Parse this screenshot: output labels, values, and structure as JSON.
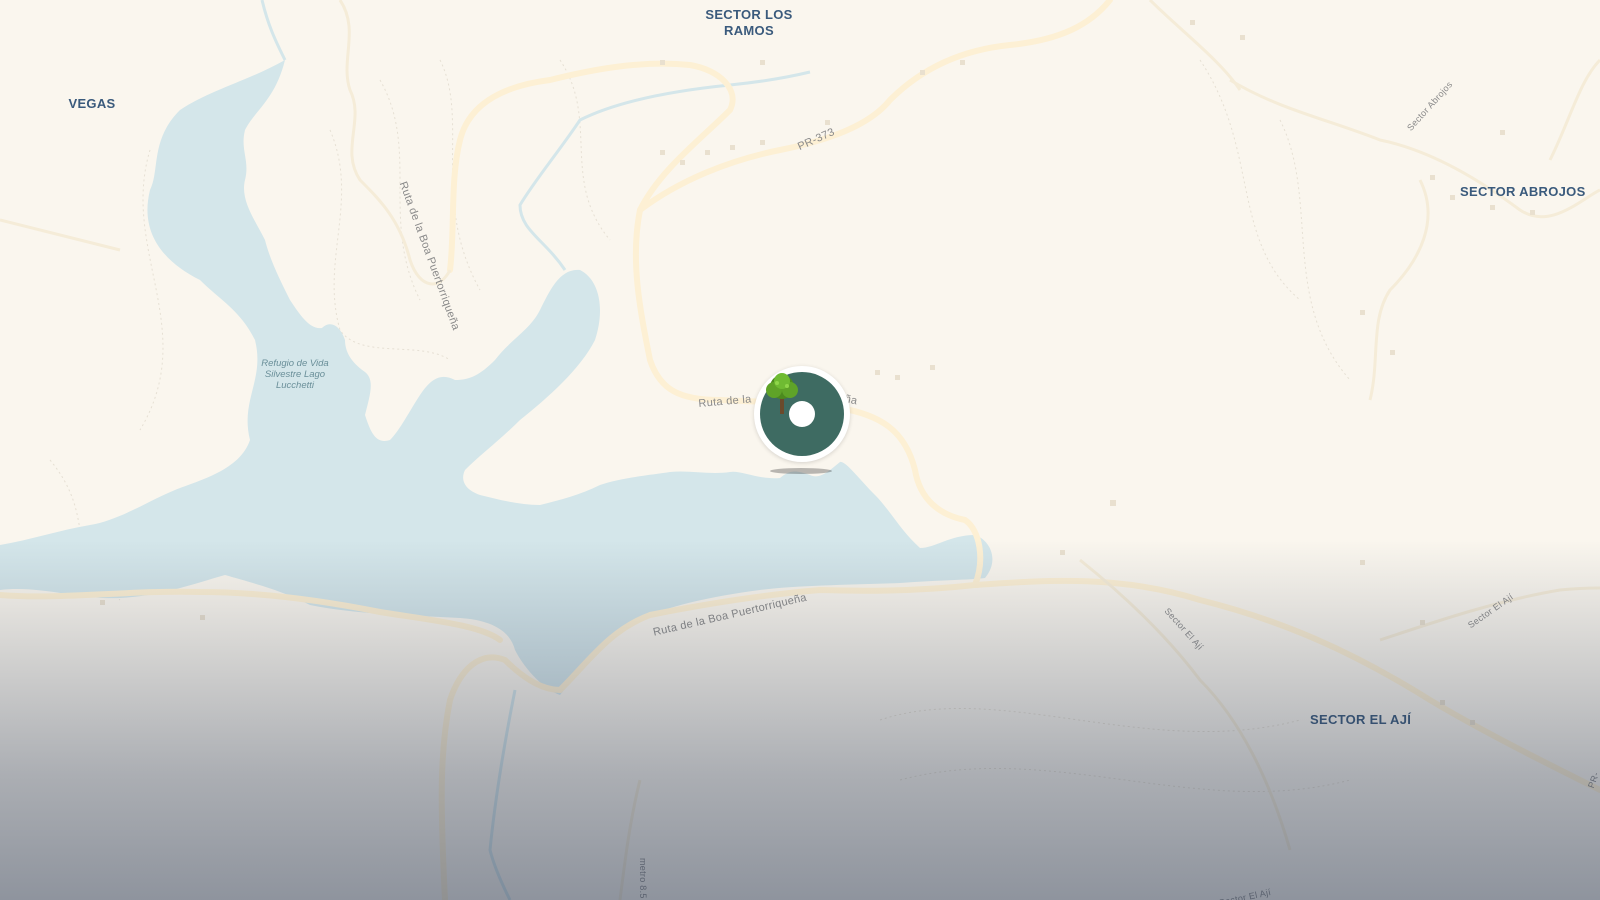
{
  "places": {
    "sector_los_ramos": "SECTOR LOS\nRAMOS",
    "vegas": "VEGAS",
    "sector_abrojos": "SECTOR ABROJOS",
    "sector_el_aji": "SECTOR EL AJÍ"
  },
  "roads": {
    "pr373": "PR-373",
    "sector_abrojos_road": "Sector Abrojos",
    "ruta_boa_vertical": "Ruta de la Boa Puertorriqueña",
    "ruta_boa_marker_left": "Ruta de la",
    "ruta_boa_marker_right": "ña",
    "ruta_boa_south": "Ruta de la Boa Puertorriqueña",
    "sector_el_aji_road1": "Sector El Ají",
    "sector_el_aji_road2": "Sector El Ají",
    "sector_el_aji_road3": "Sector El Ají",
    "pr_edge": "PR-",
    "metro": "metro 8.5"
  },
  "park": {
    "name": "Refugio de Vida Silvestre Lago Lucchetti"
  },
  "marker": {
    "icon": "tree-icon",
    "ring_color": "#ffffff",
    "disc_color": "#3e6b62"
  },
  "colors": {
    "land": "#faf6ee",
    "water": "#d4e6ea",
    "road": "#fdf3dd",
    "label": "#3a5a7c"
  }
}
